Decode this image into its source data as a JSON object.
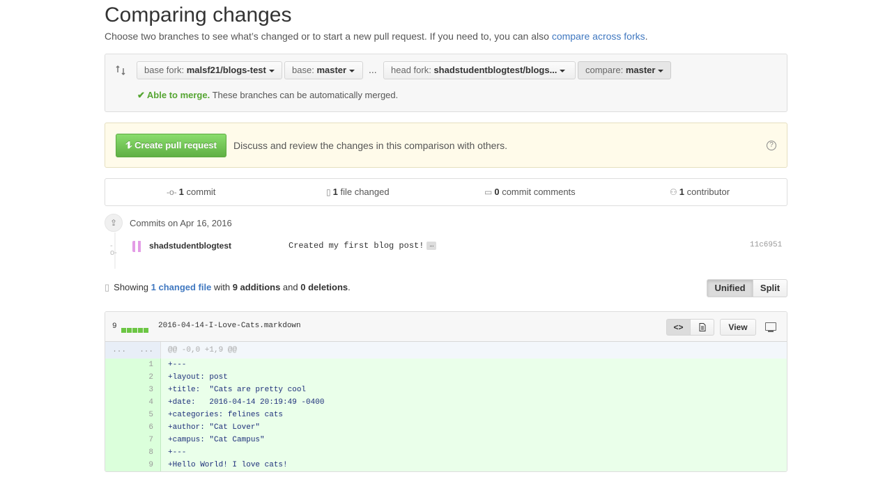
{
  "page": {
    "title": "Comparing changes",
    "subtitle_prefix": "Choose two branches to see what’s changed or to start a new pull request. If you need to, you can also ",
    "subtitle_link": "compare across forks",
    "subtitle_suffix": "."
  },
  "range": {
    "base_fork_label": "base fork:",
    "base_fork_value": "malsf21/blogs-test",
    "base_label": "base:",
    "base_value": "master",
    "dots": "...",
    "head_fork_label": "head fork:",
    "head_fork_value": "shadstudentblogtest/blogs...",
    "compare_label": "compare:",
    "compare_value": "master",
    "merge_check": "✔",
    "merge_status": "Able to merge.",
    "merge_text": "These branches can be automatically merged."
  },
  "flash": {
    "create_button": "Create pull request",
    "text": "Discuss and review the changes in this comparison with others.",
    "help": "?"
  },
  "stats": {
    "commits_count": "1",
    "commits_label": "commit",
    "files_count": "1",
    "files_label": "file changed",
    "comments_count": "0",
    "comments_label": "commit comments",
    "contributors_count": "1",
    "contributors_label": "contributor"
  },
  "commits": {
    "group_title": "Commits on Apr 16, 2016",
    "items": [
      {
        "author": "shadstudentblogtest",
        "message": "Created my first blog post!",
        "ellipsis": "…",
        "sha": "11c6951"
      }
    ]
  },
  "summary": {
    "prefix": "Showing ",
    "link": "1 changed file",
    "middle": " with ",
    "additions": "9 additions",
    "and": " and ",
    "deletions": "0 deletions",
    "suffix": "."
  },
  "view_toggle": {
    "unified": "Unified",
    "split": "Split"
  },
  "file": {
    "count": "9",
    "name": "2016-04-14-I-Love-Cats.markdown",
    "view_button": "View",
    "code_icon": "<>",
    "hunk_n1": "...",
    "hunk_n2": "...",
    "hunk": "@@ -0,0 +1,9 @@",
    "lines": [
      {
        "n": "1",
        "text": "+---"
      },
      {
        "n": "2",
        "text": "+layout: post"
      },
      {
        "n": "3",
        "text": "+title:  \"Cats are pretty cool"
      },
      {
        "n": "4",
        "text": "+date:   2016-04-14 20:19:49 -0400"
      },
      {
        "n": "5",
        "text": "+categories: felines cats"
      },
      {
        "n": "6",
        "text": "+author: \"Cat Lover\""
      },
      {
        "n": "7",
        "text": "+campus: \"Cat Campus\""
      },
      {
        "n": "8",
        "text": "+---"
      },
      {
        "n": "9",
        "text": "+Hello World! I love cats!"
      }
    ]
  },
  "colors": {
    "accent": "#4078c0",
    "success": "#55a532",
    "addition_bg": "#eaffea"
  }
}
